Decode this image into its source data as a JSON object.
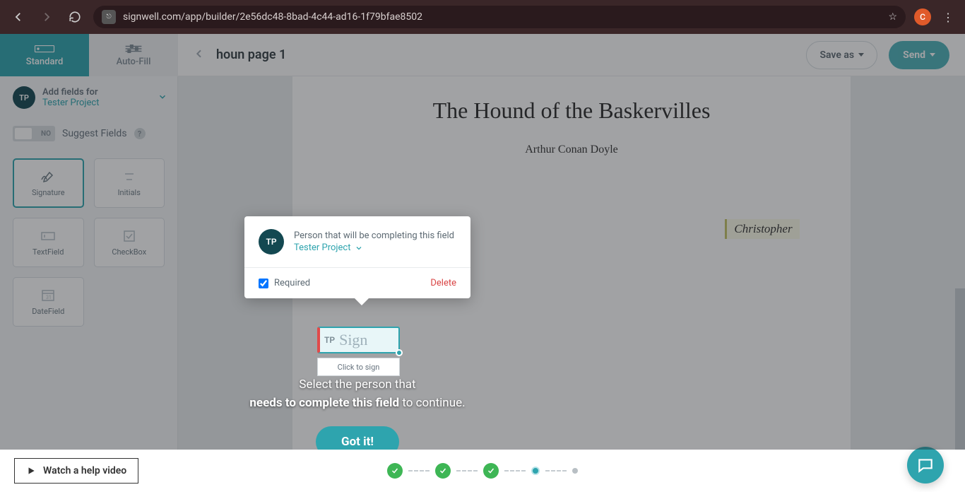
{
  "browser": {
    "url": "signwell.com/app/builder/2e56dc48-8bad-4c44-ad16-1f79bfae8502",
    "profile_initial": "C"
  },
  "sidebar_tabs": {
    "standard": "Standard",
    "autofill": "Auto-Fill"
  },
  "signer": {
    "initials": "TP",
    "line1": "Add fields for",
    "line2": "Tester Project"
  },
  "suggest": {
    "toggle": "NO",
    "label": "Suggest Fields",
    "help": "?"
  },
  "fields": {
    "signature": "Signature",
    "initials": "Initials",
    "textfield": "TextField",
    "checkbox": "CheckBox",
    "datefield": "DateField"
  },
  "topbar": {
    "title": "houn page 1",
    "save": "Save as",
    "send": "Send"
  },
  "document": {
    "title": "The Hound of the Baskervilles",
    "author": "Arthur Conan Doyle",
    "existing_signature": "Christopher"
  },
  "sig_field": {
    "badge": "TP",
    "text": "Sign",
    "tooltip": "Click to sign"
  },
  "popover": {
    "initials": "TP",
    "line1": "Person that will be completing this field",
    "line2": "Tester Project",
    "required": "Required",
    "delete": "Delete"
  },
  "tutorial": {
    "line1": "Select the person that",
    "bold": "needs to complete this field",
    "tail": " to continue.",
    "button": "Got it!"
  },
  "footer": {
    "help": "Watch a help video"
  }
}
